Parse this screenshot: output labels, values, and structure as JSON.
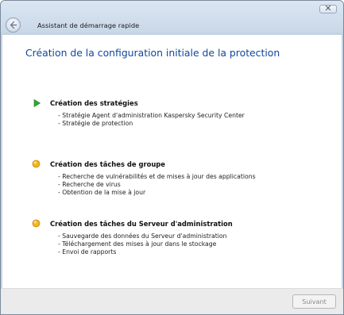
{
  "header": {
    "wizard_title": "Assistant de démarrage rapide",
    "close_glyph": "✕",
    "back_icon": "back-arrow-icon"
  },
  "main": {
    "title": "Création de la configuration initiale de la protection",
    "sections": [
      {
        "status": "in-progress",
        "icon": "green-play-arrow-icon",
        "title": "Création des stratégies",
        "items": [
          "- Stratégie Agent d'administration Kaspersky Security Center",
          "- Stratégie de protection"
        ]
      },
      {
        "status": "pending",
        "icon": "yellow-circle-icon",
        "title": "Création des tâches de groupe",
        "items": [
          "- Recherche de vulnérabilités et de mises à jour des applications",
          "- Recherche de virus",
          "- Obtention de la mise à jour"
        ]
      },
      {
        "status": "pending",
        "icon": "yellow-circle-icon",
        "title": "Création des tâches du Serveur d'administration",
        "items": [
          "- Sauvegarde des données du Serveur d'administration",
          "- Téléchargement des mises à jour dans le stockage",
          "- Envoi de rapports"
        ]
      }
    ]
  },
  "footer": {
    "next_label": "Suivant",
    "next_enabled": false
  },
  "colors": {
    "title_blue": "#12469b",
    "in_progress_green": "#2ea82e",
    "pending_yellow": "#f2b51d"
  }
}
